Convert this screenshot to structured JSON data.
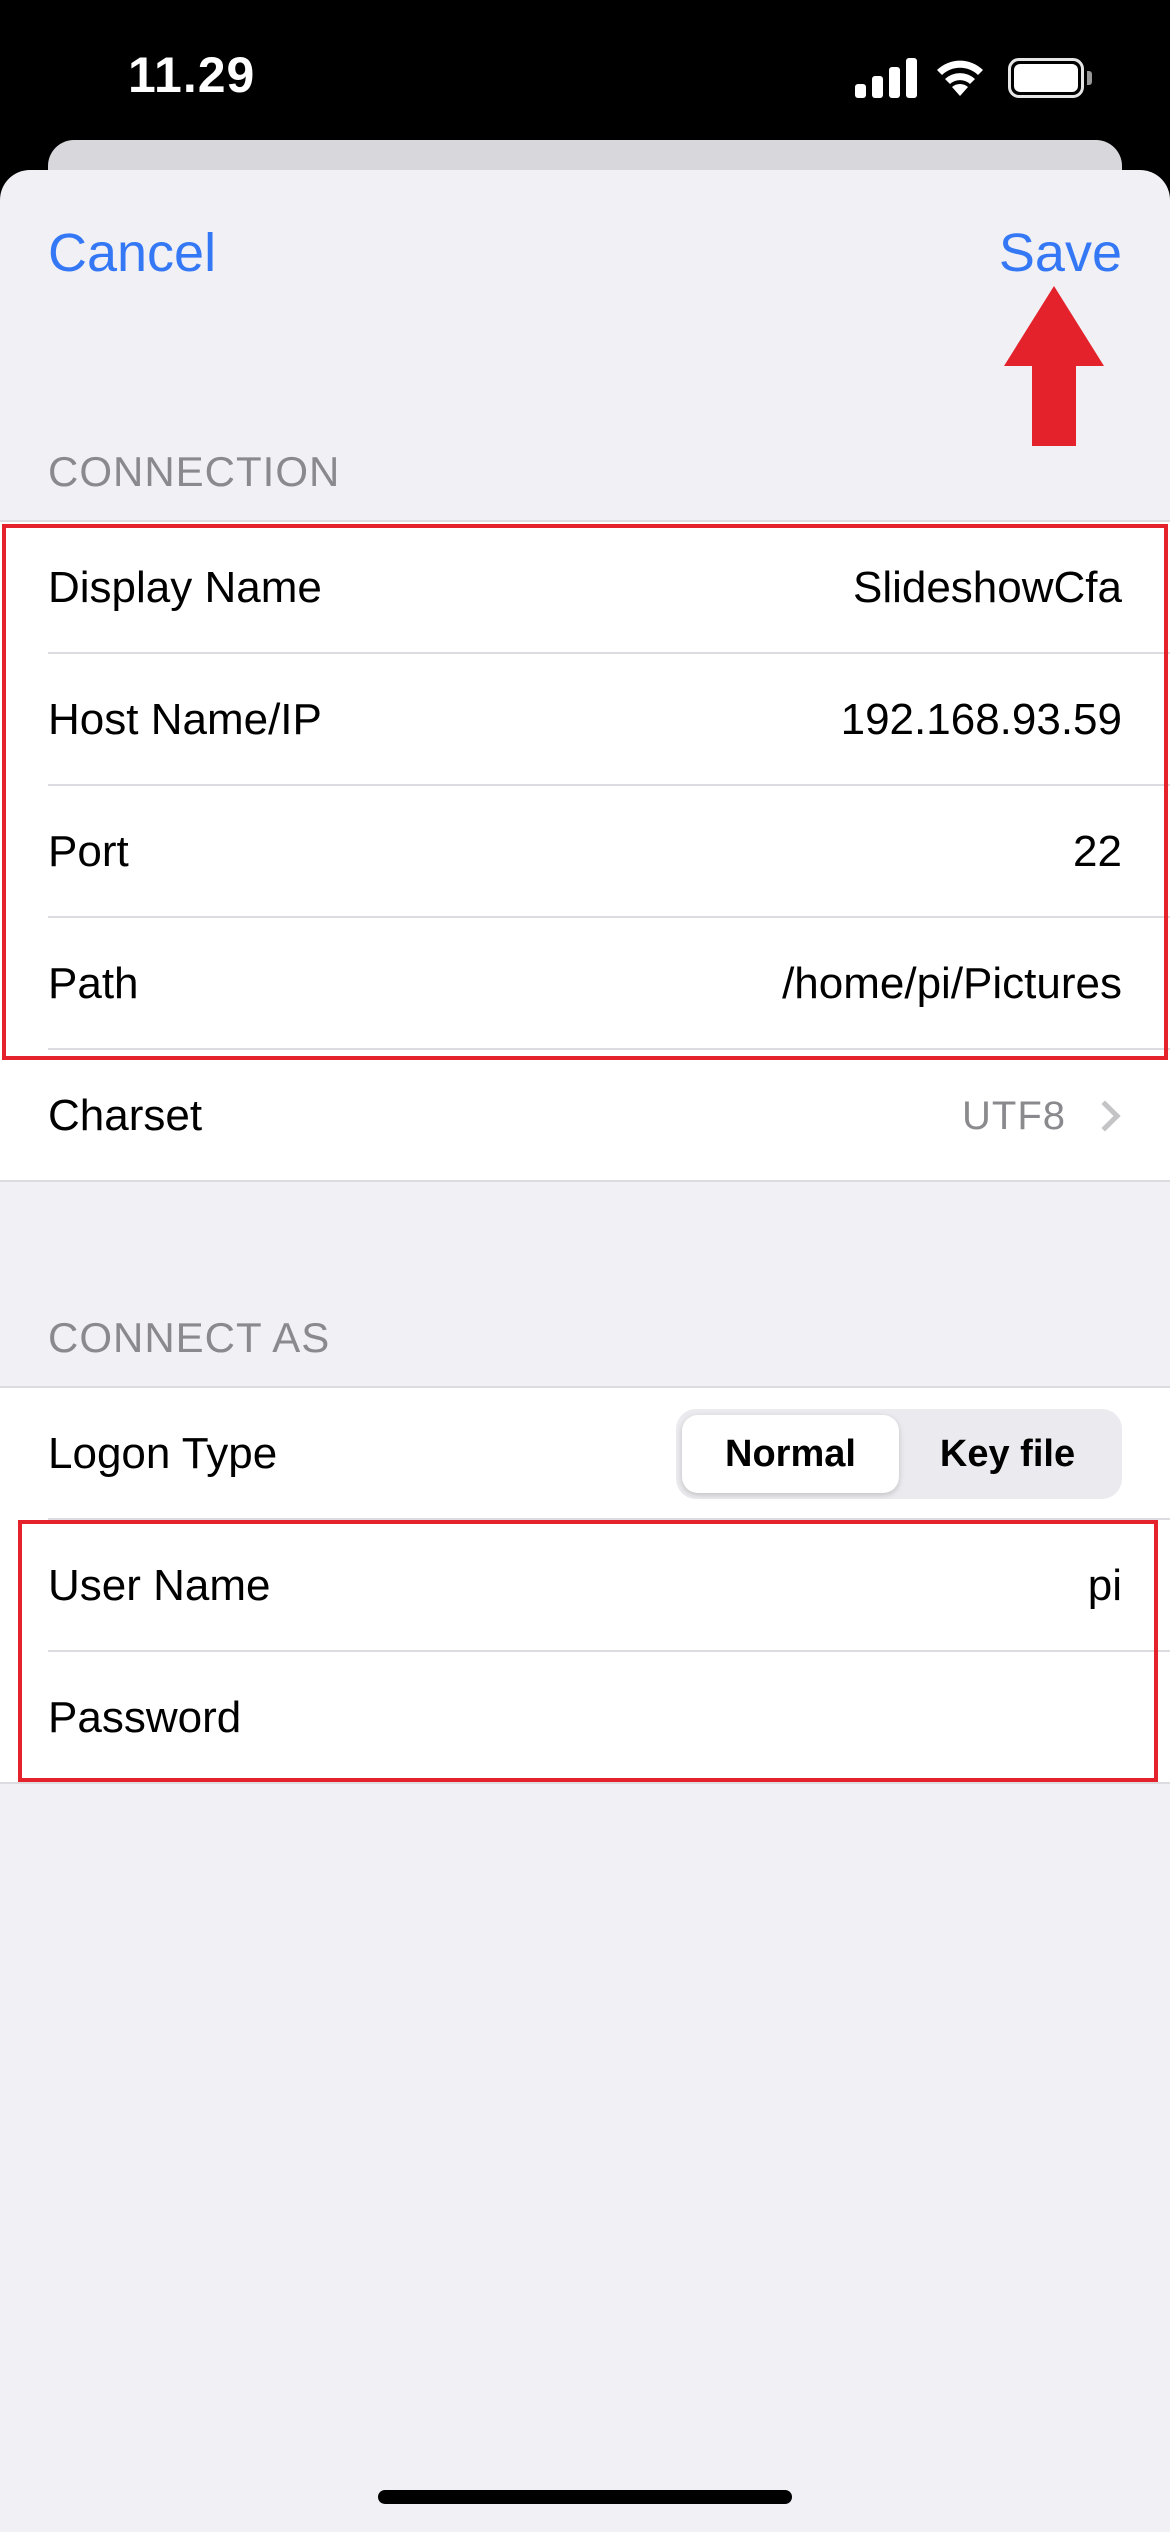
{
  "status_bar": {
    "time": "11.29"
  },
  "nav": {
    "cancel": "Cancel",
    "save": "Save"
  },
  "connection": {
    "header": "CONNECTION",
    "rows": [
      {
        "label": "Display Name",
        "value": "SlideshowCfa"
      },
      {
        "label": "Host Name/IP",
        "value": "192.168.93.59"
      },
      {
        "label": "Port",
        "value": "22"
      },
      {
        "label": "Path",
        "value": "/home/pi/Pictures"
      },
      {
        "label": "Charset",
        "value": "UTF8"
      }
    ]
  },
  "connect_as": {
    "header": "CONNECT AS",
    "logon_type": {
      "label": "Logon Type",
      "options": [
        "Normal",
        "Key file"
      ],
      "selected": "Normal"
    },
    "rows": [
      {
        "label": "User Name",
        "value": "pi"
      },
      {
        "label": "Password",
        "value": ""
      }
    ]
  },
  "colors": {
    "accent": "#3478f6",
    "annotation": "#e3222b",
    "background": "#f0f0f5"
  }
}
